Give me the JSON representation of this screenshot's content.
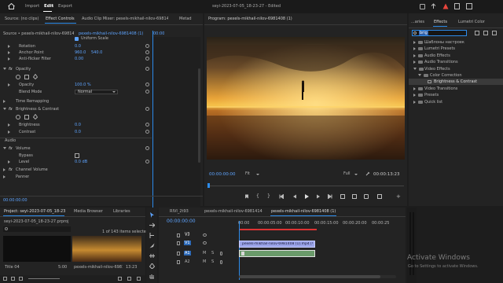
{
  "menu": {
    "home_icon": "home-icon",
    "import": "Import",
    "edit": "Edit",
    "export": "Export",
    "title": "seyi-2023-07-05_18-23-27 - Edited"
  },
  "colors": {
    "accent": "#2d8ceb",
    "bg": "#1d1d1d",
    "panel": "#232323",
    "timeline_clip": "#9aa3e8",
    "playhead_red": "#d33"
  },
  "source_panel": {
    "tabs": [
      "Source: (no clips)",
      "Effect Controls",
      "Audio Clip Mixer: pesels-mikhail-nilov-6981408 (1)",
      "Metad"
    ],
    "source_label": "Source • pexels-mikhail-nilov-6981408 (1).mp4",
    "clip_label": "pexels-mikhail-nilov-6981408 (1) • p...",
    "timecode_head": "00:00",
    "uniform_scale": "Uniform Scale",
    "rows": [
      {
        "label": "Rotation",
        "value": "0.0"
      },
      {
        "label": "Anchor Point",
        "value": "960.0",
        "value2": "540.0"
      },
      {
        "label": "Anti-flicker Filter",
        "value": "0.00"
      }
    ],
    "opacity_header": "Opacity",
    "opacity_label": "Opacity",
    "opacity_value": "100.0 %",
    "blend_label": "Blend Mode",
    "blend_value": "Normal",
    "time_remap": "Time Remapping",
    "bc_header": "Brightness & Contrast",
    "brightness_label": "Brightness",
    "brightness_value": "0.0",
    "contrast_label": "Contrast",
    "contrast_value": "0.0",
    "audio_header": "Audio",
    "volume_header": "Volume",
    "bypass_label": "Bypass",
    "level_label": "Level",
    "level_value": "0.0 dB",
    "channel_volume": "Channel Volume",
    "panner": "Panner",
    "bottom_timecode": "00:00:00:00"
  },
  "program": {
    "title": "Program: pexels-mikhail-nilov-6981408 (1)",
    "timecode": "00:00:00:00",
    "fit": "Fit",
    "quality": "Full",
    "duration": "00:00:13:23"
  },
  "effects_panel": {
    "tabs": [
      "...aries",
      "Effects",
      "Lumetri Color"
    ],
    "search_value": "brig",
    "items": [
      {
        "label": "Шаблоны настроек",
        "level": 0,
        "open": false
      },
      {
        "label": "Lumetri Presets",
        "level": 0,
        "open": false
      },
      {
        "label": "Audio Effects",
        "level": 0,
        "open": false
      },
      {
        "label": "Audio Transitions",
        "level": 0,
        "open": false
      },
      {
        "label": "Video Effects",
        "level": 0,
        "open": true
      },
      {
        "label": "Color Correction",
        "level": 1,
        "open": true
      },
      {
        "label": "Brightness & Contrast",
        "level": 2,
        "open": false,
        "selected": true
      },
      {
        "label": "Video Transitions",
        "level": 0,
        "open": false
      },
      {
        "label": "Presets",
        "level": 0,
        "open": false
      },
      {
        "label": "Quick list",
        "level": 0,
        "open": false
      }
    ]
  },
  "project_panel": {
    "tabs": [
      "Project: seyi-2023-07-05_18-23-27",
      "Media Browser",
      "Libraries"
    ],
    "file": "seyi-2023-07-05_18-23-27.prproj",
    "count": "1 of 143 items selected",
    "items": [
      {
        "name": "Title 04",
        "duration": "5:00"
      },
      {
        "name": "pexels-mikhail-nilov-69814...",
        "duration": "13:23"
      }
    ]
  },
  "timeline": {
    "tabs": [
      "RIVI_2t93",
      "pexels-mikhail-nilov-6981414",
      "pexels-mikhail-nilov-6981408 (1)"
    ],
    "timecode": "00:00:00:00",
    "ruler": [
      "00:00",
      "00:00:05:00",
      "00:00:10:00",
      "00:00:15:00",
      "00:00:20:00",
      "00:00:25"
    ],
    "tracks": [
      "V3",
      "V2",
      "V1",
      "A1",
      "A2"
    ],
    "video_clip": "pexels-mikhail-nilov-6981408 (1).mp4 [V]",
    "audio_clip_icon": "fx-badge"
  },
  "watermark": {
    "title": "Activate Windows",
    "subtitle": "Go to Settings to activate Windows."
  }
}
